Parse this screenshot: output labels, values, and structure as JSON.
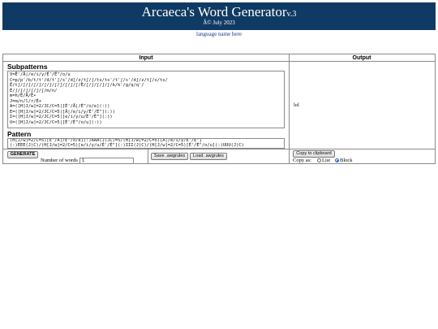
{
  "header": {
    "title": "Arcaeca's Word Generator",
    "version": "v.3",
    "subtitle": "Â© July 2023",
    "bg_color": "#0f3a63"
  },
  "language_link": "language name here",
  "input": {
    "column_title": "Input",
    "subpatterns_heading": "Subpatterns",
    "subpatterns_text": "V=Ë'/Å|/e/i/y/É'/Ë\"/o/u\nC=p/p'/b/t/t'/d/t'ʃ/s'/dʃ/z/tʃ/ʃ/ts/ts'/t'ʃ/s'/dʃ/z/tʃ/s/ts/\nË/tʃ/ʃ/ʃ/ʃ/ʃ/ʃ/ʃ/ʃ/ʃ/ʃ/ʃ/ʃ/Ë/ʃ/ʃ/ʃ/ʃ/ʃ/k/k'/g/q/q'/\nÉ/ʃ/ʃ/ʃ/ʃ/ʃ/ʃ/m/n/\nm=h/É/Å/É•\nJ=m/n/l/r/È+\nA=([H]J/w]=2/JC/C=5|[É'/Å|/É\"/o/e](:))\nE=([H]J/w]=2/JC/C=5|[Å|/e/i/y/É'/É\"](:))\nI=([H]J/w]=2/JC/C=5|[e/i/y/u/É'/É\"](:))\nU=([H]J/w]=2/JC/C=5|[É'/É\"/o/u](:))",
    "pattern_heading": "Pattern",
    "pattern_text": "(H[J/w]=2/C=5)[É'/Å|/É\"/o/e](:)AAA(J)JC)=5/(H[J/w]=2/C=5)[Å|/e/i/y/É'/É\"]\n(:)EEE(J)C)/(H[J/w]=2/C=5)[e/i/y/u/É'/É\"](:)III(J)C)/(H[J/w]=2/C=5)[É'/É\"/o/u](:)UUU(J)C)",
    "generate_label": "GENERATE",
    "num_words_label": "Number of words",
    "num_words_value": "1",
    "save_label": "Save .awgrules",
    "load_label": "Load .awgrules"
  },
  "output": {
    "column_title": "Output",
    "result": "lol",
    "copy_label": "Copy to clipboard",
    "copy_as_label": "Copy as:",
    "options": [
      "List",
      "Block"
    ],
    "selected": "Block"
  }
}
